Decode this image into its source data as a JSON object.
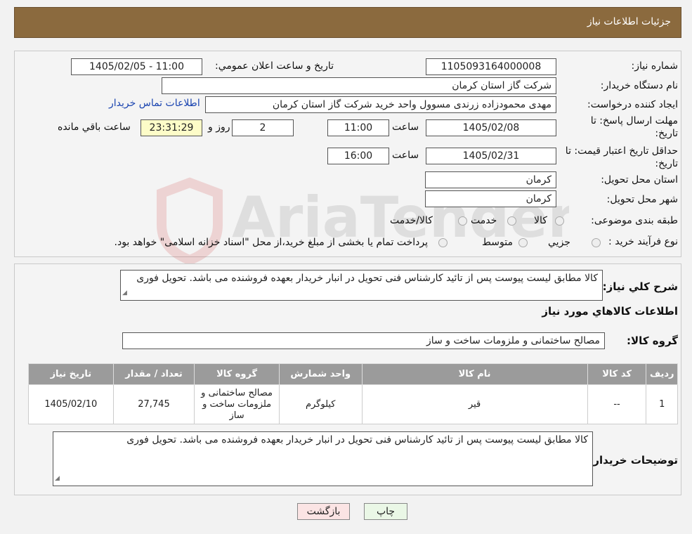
{
  "header": {
    "title": "جزئیات اطلاعات نیاز"
  },
  "details": {
    "need_number_label": "شماره نیاز:",
    "need_number": "1105093164000008",
    "announce_label": "تاریخ و ساعت اعلان عمومي:",
    "announce_value": "1405/02/05 - 11:00",
    "buyer_org_label": "نام دستگاه خريدار:",
    "buyer_org": "شرکت گاز استان کرمان",
    "creator_label": "ايجاد کننده درخواست:",
    "creator": "مهدی محمودزاده زرندی مسوول واحد خرید شرکت گاز استان کرمان",
    "contact_link": "اطلاعات تماس خريدار",
    "deadline_label": "مهلت ارسال پاسخ: تا تاريخ:",
    "deadline_date": "1405/02/08",
    "time_label": "ساعت",
    "deadline_time": "11:00",
    "days_value": "2",
    "days_label": "روز و",
    "remaining_time": "23:31:29",
    "remaining_label": "ساعت باقي مانده",
    "validity_label": "حداقل تاريخ اعتبار قيمت: تا تاريخ:",
    "validity_date": "1405/02/31",
    "validity_time": "16:00",
    "province_label": "استان محل تحويل:",
    "province": "کرمان",
    "city_label": "شهر محل تحويل:",
    "city": "کرمان",
    "category_label": "طبقه بندی موضوعی:",
    "category_options": [
      "کالا",
      "خدمت",
      "کالا/خدمت"
    ],
    "process_label": "نوع فرآيند خريد :",
    "process_options": [
      "جزيي",
      "متوسط"
    ],
    "process_note": "پرداخت تمام يا بخشی از مبلغ خريد،از محل \"اسناد خزانه اسلامی\" خواهد بود."
  },
  "description": {
    "label": "شرح کلي نياز:",
    "text": "کالا مطابق لیست پیوست پس از تائید کارشناس فنی تحویل در انبار خریدار بعهده فروشنده می باشد. تحویل فوری"
  },
  "goods": {
    "section_title": "اطلاعات کالاهاي مورد نياز",
    "group_label": "گروه کالا:",
    "group_value": "مصالح ساختمانی و ملزومات ساخت و ساز",
    "columns": [
      "رديف",
      "کد کالا",
      "نام کالا",
      "واحد شمارش",
      "گروه کالا",
      "تعداد / مقدار",
      "تاريخ نياز"
    ],
    "rows": [
      [
        "1",
        "--",
        "قیر",
        "کیلوگرم",
        "مصالح ساختمانی و ملزومات ساخت و ساز",
        "27,745",
        "1405/02/10"
      ]
    ]
  },
  "buyer_notes": {
    "label": "توضيحات خريدار:",
    "text": "کالا مطابق لیست پیوست پس از تائید کارشناس فنی تحویل در انبار خریدار بعهده فروشنده می باشد. تحویل فوری"
  },
  "buttons": {
    "print": "چاپ",
    "back": "بازگشت"
  },
  "watermark": {
    "text": "AriaTender.neT"
  }
}
